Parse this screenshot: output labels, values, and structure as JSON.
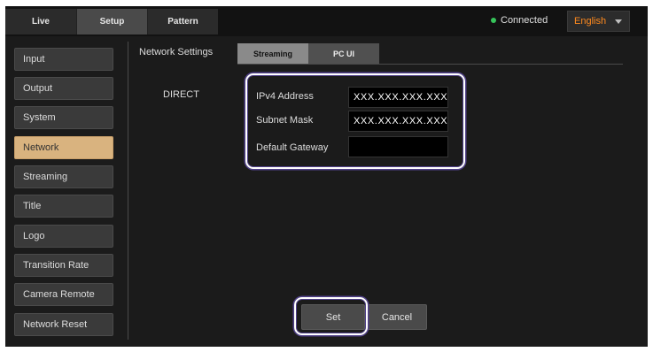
{
  "topbar": {
    "tabs": [
      {
        "label": "Live"
      },
      {
        "label": "Setup"
      },
      {
        "label": "Pattern"
      }
    ],
    "status_text": "Connected",
    "status_color": "#36c45a",
    "language": "English",
    "language_color": "#ff8a1e"
  },
  "sidebar": {
    "items": [
      {
        "label": "Input"
      },
      {
        "label": "Output"
      },
      {
        "label": "System"
      },
      {
        "label": "Network",
        "active": true
      },
      {
        "label": "Streaming"
      },
      {
        "label": "Title"
      },
      {
        "label": "Logo"
      },
      {
        "label": "Transition Rate"
      },
      {
        "label": "Camera Remote"
      },
      {
        "label": "Network Reset"
      }
    ],
    "active_color": "#d9b37f"
  },
  "main": {
    "title": "Network Settings",
    "tabs": [
      {
        "label": "Streaming",
        "selected": true
      },
      {
        "label": "PC UI"
      }
    ],
    "mode_label": "DIRECT",
    "fields": [
      {
        "label": "IPv4 Address",
        "value": "XXX.XXX.XXX.XXX"
      },
      {
        "label": "Subnet Mask",
        "value": "XXX.XXX.XXX.XXX"
      },
      {
        "label": "Default Gateway",
        "value": ""
      }
    ],
    "buttons": {
      "set": "Set",
      "cancel": "Cancel"
    }
  }
}
